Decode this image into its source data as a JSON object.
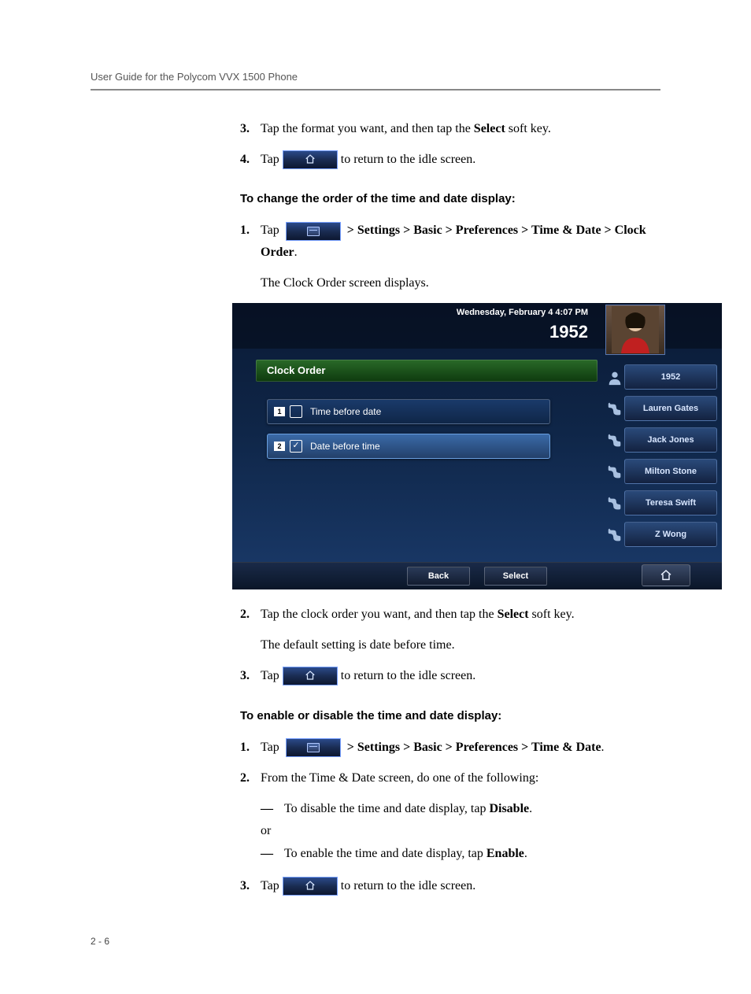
{
  "header": "User Guide for the Polycom VVX 1500 Phone",
  "page_number": "2 - 6",
  "sec1": {
    "step3_a": "Tap the format you want, and then tap the ",
    "step3_b": "Select",
    "step3_c": " soft key.",
    "step4_a": "Tap ",
    "step4_b": " to return to the idle screen."
  },
  "heading_order": "To change the order of the time and date display:",
  "sec2": {
    "step1_a": "Tap ",
    "step1_b": " > Settings > Basic > Preferences > Time & Date > Clock Order",
    "step1_c": ".",
    "step1_after": "The Clock Order screen displays.",
    "step2_a": "Tap the clock order you want, and then tap the ",
    "step2_b": "Select",
    "step2_c": " soft key.",
    "step2_after": "The default setting is date before time.",
    "step3_a": "Tap ",
    "step3_b": " to return to the idle screen."
  },
  "heading_enable": "To enable or disable the time and date display:",
  "sec3": {
    "step1_a": "Tap ",
    "step1_b": " > Settings > Basic > Preferences > Time & Date",
    "step1_c": ".",
    "step2": "From the Time & Date screen, do one of the following:",
    "dash1_a": "To disable the time and date display, tap ",
    "dash1_b": "Disable",
    "dash1_c": ".",
    "or": "or",
    "dash2_a": "To enable the time and date display, tap ",
    "dash2_b": "Enable",
    "dash2_c": ".",
    "step3_a": "Tap ",
    "step3_b": " to return to the idle screen."
  },
  "mock": {
    "datetime": "Wednesday, February 4  4:07 PM",
    "ext": "1952",
    "title": "Clock Order",
    "opt1_num": "1",
    "opt1_label": "Time before date",
    "opt2_num": "2",
    "opt2_label": "Date before time",
    "side0": "1952",
    "side1": "Lauren Gates",
    "side2": "Jack Jones",
    "side3": "Milton Stone",
    "side4": "Teresa Swift",
    "side5": "Z Wong",
    "soft_back": "Back",
    "soft_select": "Select"
  },
  "nums": {
    "n1": "1.",
    "n2": "2.",
    "n3": "3.",
    "n4": "4.",
    "dash": "—"
  }
}
